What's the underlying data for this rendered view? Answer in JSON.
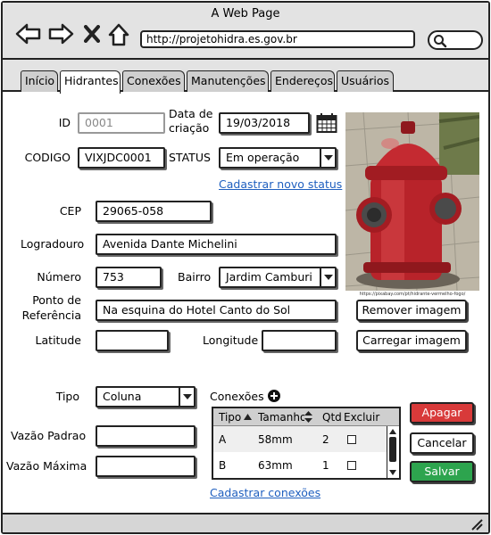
{
  "window": {
    "title": "A Web Page"
  },
  "browser": {
    "url": "http://projetohidra.es.gov.br"
  },
  "tabs": [
    "Início",
    "Hidrantes",
    "Conexões",
    "Manutenções",
    "Endereços",
    "Usuários"
  ],
  "active_tab": "Hidrantes",
  "form": {
    "id_label": "ID",
    "id_value": "0001",
    "data_criacao_label_1": "Data de",
    "data_criacao_label_2": "criação",
    "data_criacao_value": "19/03/2018",
    "codigo_label": "CODIGO",
    "codigo_value": "VIXJDC0001",
    "status_label": "STATUS",
    "status_value": "Em operação",
    "cadastrar_status_link": "Cadastrar novo status",
    "cep_label": "CEP",
    "cep_value": "29065-058",
    "logradouro_label": "Logradouro",
    "logradouro_value": "Avenida Dante Michelini",
    "numero_label": "Número",
    "numero_value": "753",
    "bairro_label": "Bairro",
    "bairro_value": "Jardim Camburi",
    "ponto_label_1": "Ponto de",
    "ponto_label_2": "Referência",
    "ponto_value": "Na esquina do Hotel Canto do Sol",
    "latitude_label": "Latitude",
    "latitude_value": "",
    "longitude_label": "Longitude",
    "longitude_value": "",
    "tipo_label": "Tipo",
    "tipo_value": "Coluna",
    "vazao_padrao_label": "Vazão Padrao",
    "vazao_padrao_value": "",
    "vazao_maxima_label": "Vazão Máxima",
    "vazao_maxima_value": ""
  },
  "image": {
    "caption": "https://pixabay.com/pt/hidrante-vermelho-fogo/",
    "remove_button": "Remover imagem",
    "upload_button": "Carregar imagem"
  },
  "conexoes": {
    "label": "Conexões",
    "columns": [
      "Tipo",
      "Tamanho",
      "Qtd",
      "Excluir"
    ],
    "rows": [
      {
        "tipo": "A",
        "tamanho": "58mm",
        "qtd": "2",
        "excluir": false
      },
      {
        "tipo": "B",
        "tamanho": "63mm",
        "qtd": "1",
        "excluir": false
      }
    ],
    "cadastrar_link": "Cadastrar conexões"
  },
  "actions": {
    "apagar": "Apagar",
    "cancelar": "Cancelar",
    "salvar": "Salvar"
  },
  "colors": {
    "accent_red": "#d83a3a",
    "accent_green": "#2da44e",
    "link_blue": "#1f5fbf"
  },
  "icons": [
    "back-arrow-icon",
    "forward-arrow-icon",
    "close-icon",
    "home-icon",
    "search-icon",
    "calendar-icon",
    "add-circle-icon",
    "sort-up-icon",
    "sort-updown-icon",
    "resize-grip-icon"
  ]
}
